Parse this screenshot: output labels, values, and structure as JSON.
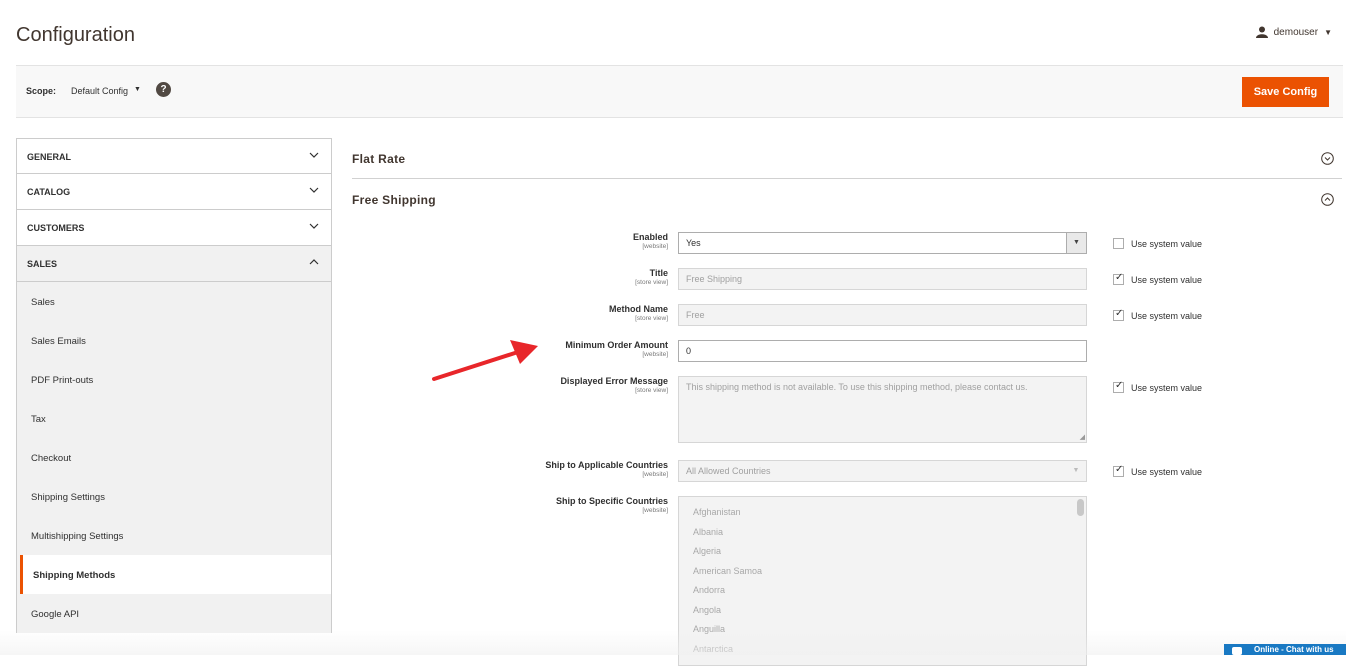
{
  "header": {
    "title": "Configuration",
    "user": "demouser"
  },
  "scope": {
    "label": "Scope:",
    "value": "Default Config",
    "save_label": "Save Config"
  },
  "sidebar": {
    "sections": [
      {
        "label": "GENERAL"
      },
      {
        "label": "CATALOG"
      },
      {
        "label": "CUSTOMERS"
      },
      {
        "label": "SALES"
      }
    ],
    "sales_items": [
      "Sales",
      "Sales Emails",
      "PDF Print-outs",
      "Tax",
      "Checkout",
      "Shipping Settings",
      "Multishipping Settings",
      "Shipping Methods",
      "Google API"
    ],
    "active_item": "Shipping Methods"
  },
  "main": {
    "group_flat": "Flat Rate",
    "group_free": "Free Shipping",
    "use_system": "Use system value",
    "fields": {
      "enabled": {
        "label": "Enabled",
        "scope": "[website]",
        "value": "Yes",
        "use_system": false
      },
      "title": {
        "label": "Title",
        "scope": "[store view]",
        "value": "Free Shipping",
        "use_system": true
      },
      "method_name": {
        "label": "Method Name",
        "scope": "[store view]",
        "value": "Free",
        "use_system": true
      },
      "min_order": {
        "label": "Minimum Order Amount",
        "scope": "[website]",
        "value": "0"
      },
      "error_msg": {
        "label": "Displayed Error Message",
        "scope": "[store view]",
        "value": "This shipping method is not available. To use this shipping method, please contact us.",
        "use_system": true
      },
      "applicable": {
        "label": "Ship to Applicable Countries",
        "scope": "[website]",
        "value": "All Allowed Countries",
        "use_system": true
      },
      "specific": {
        "label": "Ship to Specific Countries",
        "scope": "[website]",
        "options": [
          "Afghanistan",
          "Albania",
          "Algeria",
          "American Samoa",
          "Andorra",
          "Angola",
          "Anguilla",
          "Antarctica"
        ]
      }
    }
  },
  "chat": {
    "label": "Online - Chat with us"
  },
  "colors": {
    "accent": "#eb5202",
    "arrow": "#e8262a",
    "chat": "#1979c3"
  }
}
